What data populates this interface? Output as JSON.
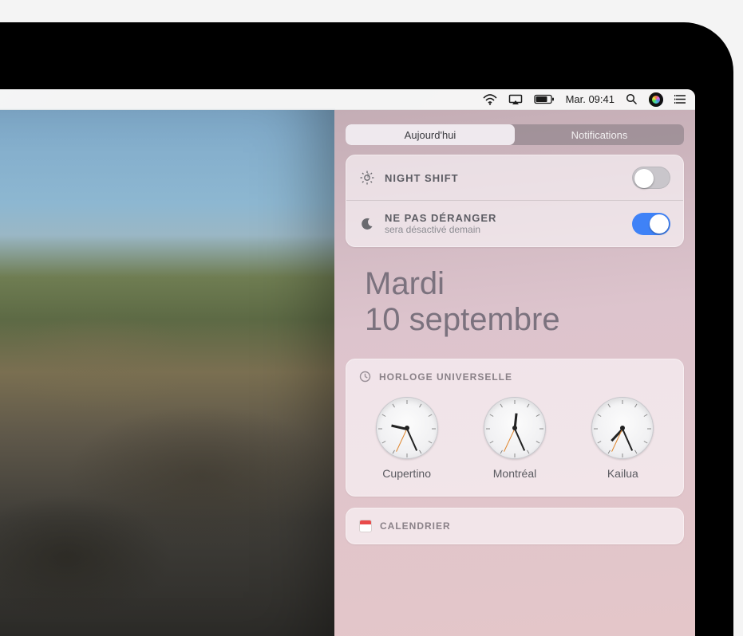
{
  "menubar": {
    "datetime": "Mar. 09:41"
  },
  "tabs": {
    "today": "Aujourd'hui",
    "notifications": "Notifications"
  },
  "settings": {
    "night_shift": {
      "title": "NIGHT SHIFT",
      "enabled": false
    },
    "dnd": {
      "title": "NE PAS DÉRANGER",
      "subtitle": "sera désactivé demain",
      "enabled": true
    }
  },
  "date_header": {
    "line1": "Mardi",
    "line2": "10 septembre"
  },
  "widgets": {
    "world_clock": {
      "title": "HORLOGE UNIVERSELLE",
      "clocks": [
        {
          "label": "Cupertino",
          "hour_angle": 283,
          "minute_angle": 156,
          "second_angle": 205
        },
        {
          "label": "Montréal",
          "hour_angle": 6,
          "minute_angle": 156,
          "second_angle": 205
        },
        {
          "label": "Kailua",
          "hour_angle": 223,
          "minute_angle": 156,
          "second_angle": 205
        }
      ]
    },
    "calendar": {
      "title": "CALENDRIER"
    }
  }
}
